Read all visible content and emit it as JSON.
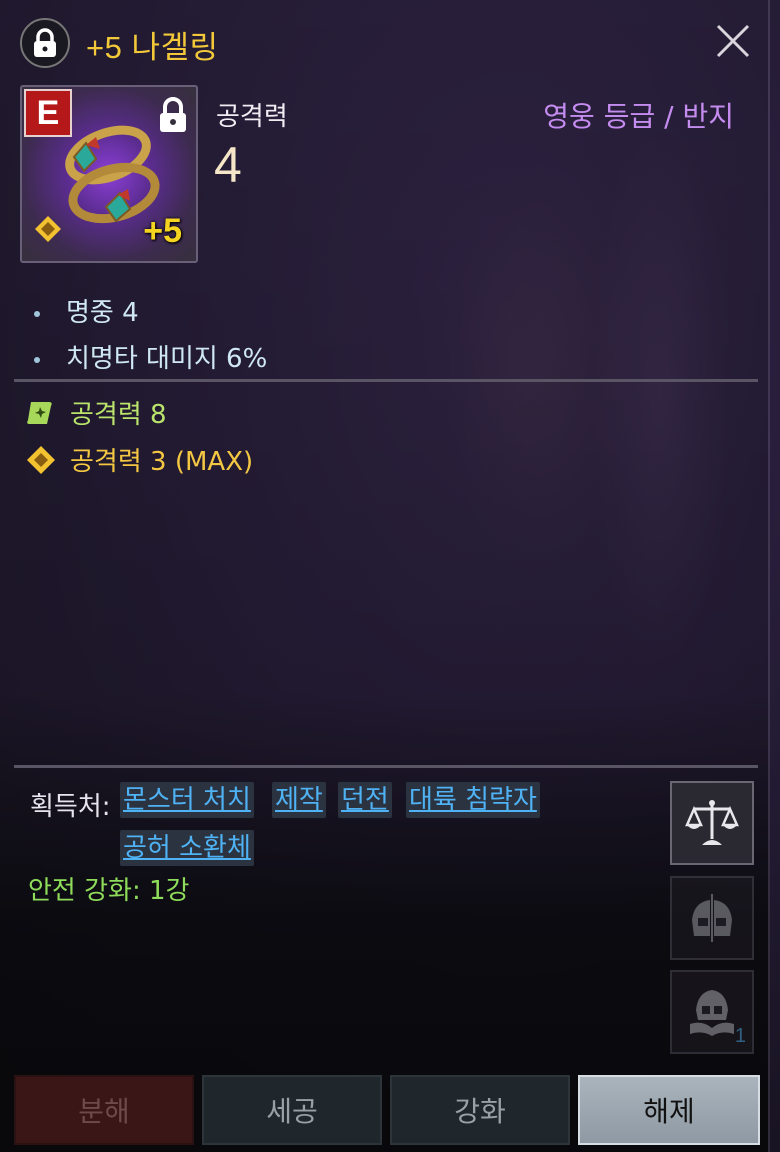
{
  "header": {
    "title": "+5 나겔링"
  },
  "item": {
    "grade_letter": "E",
    "enhance_label": "+5",
    "stat_name": "공격력",
    "stat_value": "4",
    "category": "영웅 등급 / 반지"
  },
  "bonuses": [
    {
      "label": "명중 4"
    },
    {
      "label": "치명타 대미지 6%"
    }
  ],
  "sub_options": [
    {
      "label": "공격력 8",
      "icon": "green-leaf-icon",
      "color": "#b9e36a"
    },
    {
      "label": "공격력 3 (MAX)",
      "icon": "gold-diamond-icon",
      "color": "#f4c743"
    }
  ],
  "acquisition": {
    "label": "획득처:",
    "sources": [
      "몬스터 처치",
      "제작",
      "던전",
      "대륙 침략자",
      "공허 소환체"
    ]
  },
  "safe_enhance": "안전 강화: 1강",
  "side_buttons": [
    {
      "icon": "scale-icon"
    },
    {
      "icon": "helmet-compare-icon"
    },
    {
      "icon": "helmet-book-icon",
      "count": "1"
    }
  ],
  "buttons": {
    "disassemble": "분해",
    "polish": "세공",
    "enhance": "강화",
    "release": "해제"
  }
}
